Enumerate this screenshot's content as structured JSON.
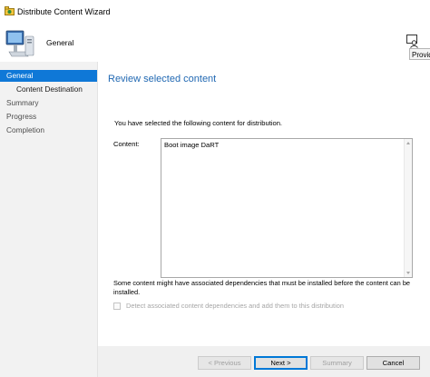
{
  "window": {
    "title": "Distribute Content Wizard"
  },
  "header": {
    "title": "General",
    "icon": "computer-monitor-icon"
  },
  "help": {
    "icon": "help-person-icon",
    "tooltip": "Provide"
  },
  "sidebar": {
    "items": [
      {
        "label": "General",
        "selected": true,
        "sub": false
      },
      {
        "label": "Content Destination",
        "selected": false,
        "sub": true
      },
      {
        "label": "Summary",
        "selected": false,
        "sub": false
      },
      {
        "label": "Progress",
        "selected": false,
        "sub": false
      },
      {
        "label": "Completion",
        "selected": false,
        "sub": false
      }
    ]
  },
  "main": {
    "section_title": "Review selected content",
    "intro": "You have selected the following content for distribution.",
    "content_label": "Content:",
    "content_items": [
      "Boot image DaRT"
    ],
    "dependency_note": "Some content might have associated dependencies that must be installed before the content can be installed.",
    "checkbox_label": "Detect associated content dependencies and add them to this distribution",
    "checkbox_checked": false,
    "checkbox_enabled": false
  },
  "buttons": {
    "previous": "< Previous",
    "next": "Next >",
    "summary": "Summary",
    "cancel": "Cancel"
  },
  "colors": {
    "accent": "#0f78d7",
    "section_title": "#2269b3",
    "sidebar_bg": "#f2f2f2",
    "button_bar_bg": "#f0f0f0"
  }
}
